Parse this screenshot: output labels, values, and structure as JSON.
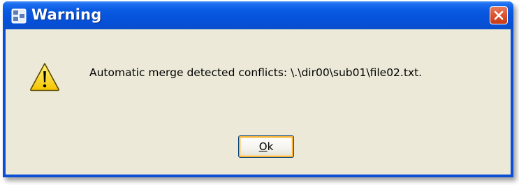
{
  "window": {
    "title": "Warning",
    "icon": "app-window-icon",
    "close_icon": "close-icon"
  },
  "dialog": {
    "icon": "warning-icon",
    "message": "Automatic merge detected conflicts: \\.\\dir00\\sub01\\file02.txt.",
    "ok_button": {
      "mnemonic": "O",
      "rest": "k"
    }
  },
  "colors": {
    "titlebar": "#0754dc",
    "body": "#ece9d8",
    "close": "#dc5632",
    "warning": "#ffd200"
  }
}
